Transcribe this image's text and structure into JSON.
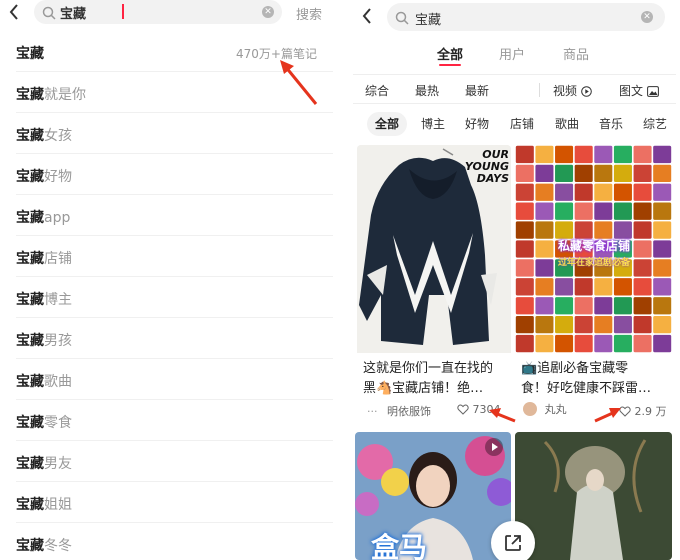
{
  "colors": {
    "accent": "#ff2442",
    "arrow": "#e5341d"
  },
  "left": {
    "back_icon": "chevron-left-icon",
    "search_query": "宝藏",
    "search_button": "搜索",
    "suggestions": [
      {
        "keyword": "宝藏",
        "rest": "",
        "count": "470万+篇笔记"
      },
      {
        "keyword": "宝藏",
        "rest": "就是你"
      },
      {
        "keyword": "宝藏",
        "rest": "女孩"
      },
      {
        "keyword": "宝藏",
        "rest": "好物"
      },
      {
        "keyword": "宝藏",
        "rest": "app"
      },
      {
        "keyword": "宝藏",
        "rest": "店铺"
      },
      {
        "keyword": "宝藏",
        "rest": "博主"
      },
      {
        "keyword": "宝藏",
        "rest": "男孩"
      },
      {
        "keyword": "宝藏",
        "rest": "歌曲"
      },
      {
        "keyword": "宝藏",
        "rest": "零食"
      },
      {
        "keyword": "宝藏",
        "rest": "男友"
      },
      {
        "keyword": "宝藏",
        "rest": "姐姐"
      },
      {
        "keyword": "宝藏",
        "rest": "冬冬"
      }
    ]
  },
  "right": {
    "search_query": "宝藏",
    "main_tabs": [
      "全部",
      "用户",
      "商品"
    ],
    "sort": {
      "items": [
        "综合",
        "最热",
        "最新"
      ],
      "video": "视频",
      "image_text": "图文"
    },
    "chips": [
      "全部",
      "博主",
      "好物",
      "店铺",
      "歌曲",
      "音乐",
      "综艺"
    ],
    "cards": [
      {
        "image_caption": [
          "OUR",
          "YOUNG",
          "DAYS"
        ],
        "title_line1": "这就是你们一直在找的",
        "title_line2": "黑🐴宝藏店铺！绝…",
        "author": "明依服饰",
        "likes": "7304"
      },
      {
        "overlay": [
          "私藏零食店铺",
          "过年在家追剧必备"
        ],
        "title_line1": "📺追剧必备宝藏零",
        "title_line2": "食！好吃健康不踩雷…",
        "author": "丸丸",
        "likes": "2.9 万"
      },
      {
        "overlay": "盒马"
      },
      {}
    ]
  }
}
